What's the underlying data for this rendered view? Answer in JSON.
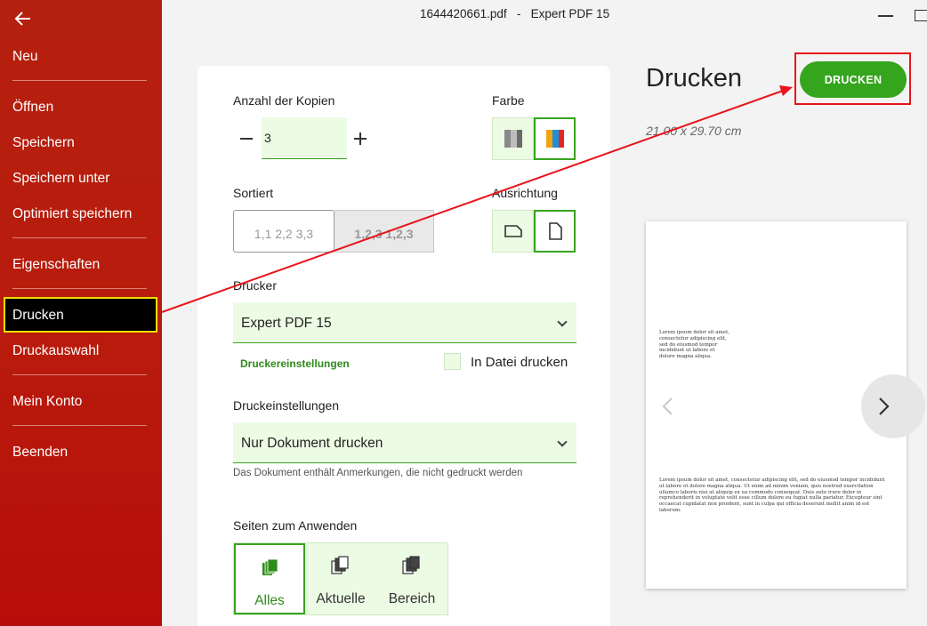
{
  "window": {
    "filename": "1644420661.pdf",
    "separator": "-",
    "app_name": "Expert PDF 15"
  },
  "sidebar": {
    "items": [
      {
        "label": "Neu"
      },
      {
        "label": "Öffnen"
      },
      {
        "label": "Speichern"
      },
      {
        "label": "Speichern unter"
      },
      {
        "label": "Optimiert speichern"
      },
      {
        "label": "Eigenschaften"
      },
      {
        "label": "Drucken",
        "active": true
      },
      {
        "label": "Druckauswahl"
      },
      {
        "label": "Mein Konto"
      },
      {
        "label": "Beenden"
      }
    ]
  },
  "settings": {
    "copies_label": "Anzahl der Kopien",
    "copies_value": "3",
    "color_label": "Farbe",
    "collate_label": "Sortiert",
    "collate_options": [
      "1,1 2,2 3,3",
      "1,2,3 1,2,3"
    ],
    "collate_selected": "1,2,3 1,2,3",
    "orientation_label": "Ausrichtung",
    "printer_label": "Drucker",
    "printer_value": "Expert PDF 15",
    "printer_settings_link": "Druckereinstellungen",
    "print_to_file_label": "In Datei drucken",
    "print_to_file_checked": false,
    "print_settings_label": "Druckeinstellungen",
    "print_settings_value": "Nur Dokument drucken",
    "annotations_note": "Das Dokument enthält Anmerkungen, die nicht gedruckt werden",
    "pages_label": "Seiten zum Anwenden",
    "pages_options": [
      "Alles",
      "Aktuelle",
      "Bereich"
    ],
    "pages_selected": "Alles"
  },
  "print_panel": {
    "heading": "Drucken",
    "page_size": "21.00 x 29.70 cm",
    "print_button": "DRUCKEN"
  },
  "preview": {
    "text1": "Lorem ipsum dolor sit amet, consectetur adipiscing elit, sed do eiusmod tempor incididunt ut labore et dolore magna aliqua.",
    "text2": "Lorem ipsum dolor sit amet, consectetur adipiscing elit, sed do eiusmod tempor incididunt ut labore et dolore magna aliqua. Ut enim ad minim veniam, quis nostrud exercitation ullamco laboris nisi ut aliquip ex ea commodo consequat. Duis aute irure dolor in reprehenderit in voluptate velit esse cillum dolore eu fugiat nulla pariatur. Excepteur sint occaecat cupidatat non proident, sunt in culpa qui officia deserunt mollit anim id est laborum."
  },
  "colors": {
    "sidebar_red": "#b81b0c",
    "accent_green": "#34a51d",
    "highlight_yellow": "#f2e000",
    "annotation_red": "#e8141b"
  },
  "icons": [
    "back-arrow-icon",
    "grayscale-icon",
    "color-bars-icon",
    "landscape-icon",
    "portrait-icon",
    "chevron-down-icon",
    "pages-all-icon",
    "page-current-icon",
    "page-range-icon",
    "chevron-left-icon",
    "chevron-right-icon"
  ]
}
